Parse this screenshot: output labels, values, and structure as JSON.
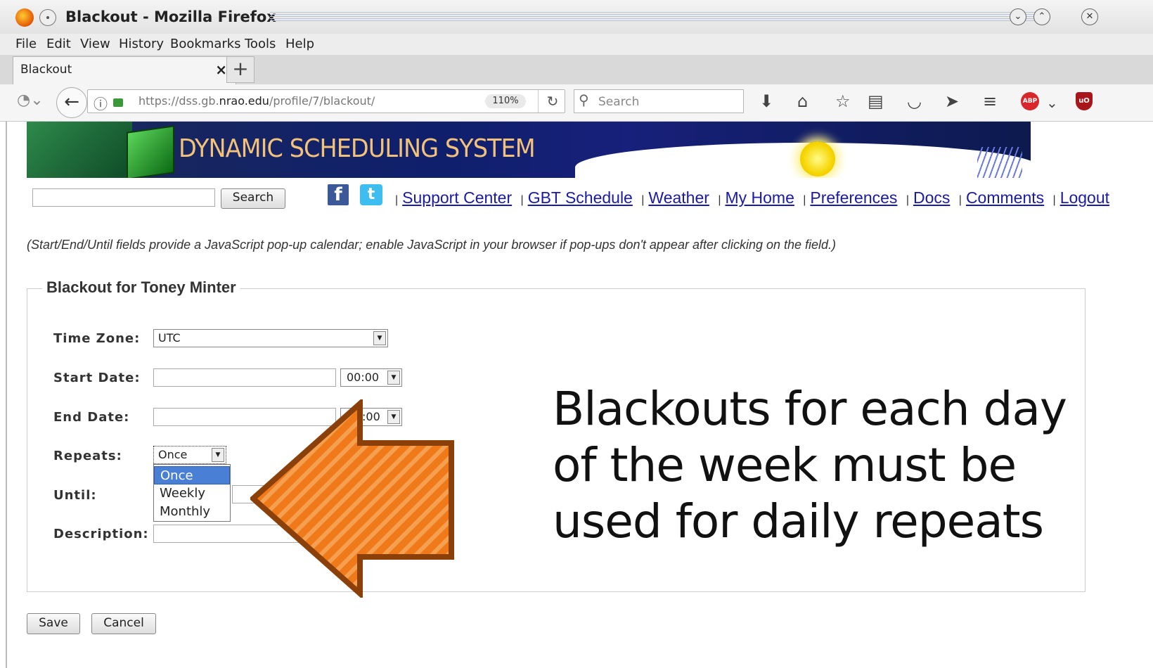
{
  "window": {
    "title": "Blackout - Mozilla Firefox"
  },
  "menu": [
    "File",
    "Edit",
    "View",
    "History",
    "Bookmarks",
    "Tools",
    "Help"
  ],
  "tab": {
    "label": "Blackout",
    "close": "×",
    "new": "+"
  },
  "navbar": {
    "url_prefix": "https://dss.gb.",
    "url_domain": "nrao.edu",
    "url_path": "/profile/7/blackout/",
    "zoom": "110%",
    "search_placeholder": "Search"
  },
  "site": {
    "banner_title": "DYNAMIC SCHEDULING SYSTEM",
    "search_button": "Search",
    "links": [
      "Support Center",
      "GBT Schedule",
      "Weather",
      "My Home",
      "Preferences",
      "Docs",
      "Comments",
      "Logout"
    ]
  },
  "note": "(Start/End/Until fields provide a JavaScript pop-up calendar; enable JavaScript in your browser if pop-ups don't appear after clicking on the field.)",
  "form": {
    "legend": "Blackout for Toney Minter",
    "labels": {
      "timezone": "Time Zone:",
      "start": "Start Date:",
      "end": "End Date:",
      "repeats": "Repeats:",
      "until": "Until:",
      "description": "Description:"
    },
    "timezone_value": "UTC",
    "start_time": "00:00",
    "end_time": ":00",
    "repeats_value": "Once",
    "repeats_options": [
      "Once",
      "Weekly",
      "Monthly"
    ],
    "save": "Save",
    "cancel": "Cancel"
  },
  "annotation": {
    "line1": "Blackouts for each day",
    "line2": "of the week must be",
    "line3": "used for daily repeats",
    "arrow_color": "#f07a1a"
  }
}
